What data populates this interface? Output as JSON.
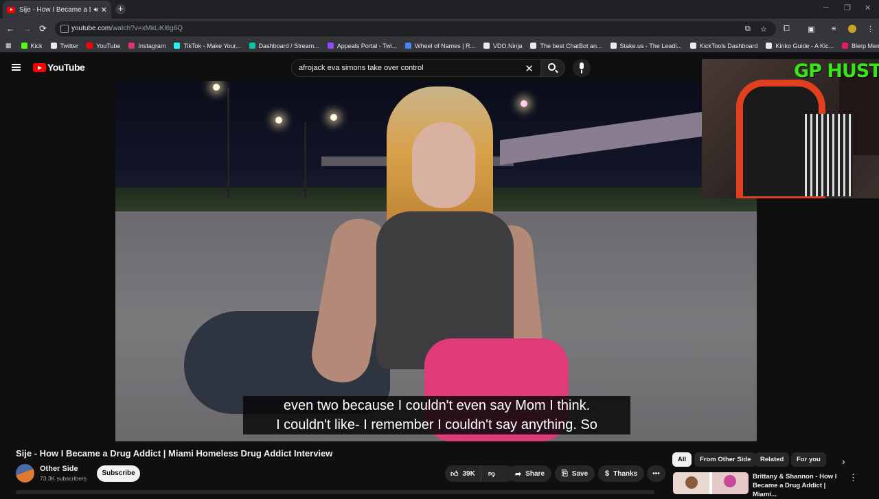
{
  "browser": {
    "tab": {
      "title": "Sije - How I Became a Drug",
      "new_tab": "+"
    },
    "window_controls": {
      "minimize": "─",
      "restore": "❐",
      "close": "✕"
    },
    "nav": {
      "back": "←",
      "forward": "→",
      "reload": "⟳"
    },
    "url": {
      "host": "youtube.com",
      "path": "/watch?v=xMkLiKl6g6Q"
    },
    "bookmarks": [
      {
        "label": "Kick",
        "color": "#53fc18"
      },
      {
        "label": "Twitter",
        "color": "#e8eaed"
      },
      {
        "label": "YouTube",
        "color": "#ff0000"
      },
      {
        "label": "Instagram",
        "color": "#e1306c"
      },
      {
        "label": "TikTok - Make Your...",
        "color": "#25f4ee"
      },
      {
        "label": "Dashboard / Stream...",
        "color": "#00c8a0"
      },
      {
        "label": "Appeals Portal - Twi...",
        "color": "#9146ff"
      },
      {
        "label": "Wheel of Names | R...",
        "color": "#4285f4"
      },
      {
        "label": "VDO.Ninja",
        "color": "#e8eaed"
      },
      {
        "label": "The best ChatBot an...",
        "color": "#e8eaed"
      },
      {
        "label": "Stake.us - The Leadi...",
        "color": "#e8eaed"
      },
      {
        "label": "KickTools Dashboard",
        "color": "#e8eaed"
      },
      {
        "label": "Kinko Guide - A Kic...",
        "color": "#e8eaed"
      },
      {
        "label": "Blerp Memes | Best...",
        "color": "#e5195f"
      }
    ]
  },
  "youtube": {
    "logo": "YouTube",
    "search": {
      "query": "afrojack eva simons take over control"
    },
    "video": {
      "caption_line1": "even two because I couldn't even say Mom I think.",
      "caption_line2": "I couldn't like- I remember I couldn't say anything. So",
      "title": "Sije - How I Became a Drug Addict | Miami Homeless Drug Addict Interview"
    },
    "stream_overlay": {
      "label": "GP HUSTLA"
    },
    "channel": {
      "name": "Other Side",
      "subscribers": "73.3K subscribers",
      "subscribe_label": "Subscribe"
    },
    "actions": {
      "likes": "39K",
      "share": "Share",
      "save": "Save",
      "thanks": "Thanks",
      "more": "•••"
    },
    "chips": [
      "All",
      "From Other Side",
      "Related",
      "For you"
    ],
    "recommendation": {
      "title": "Brittany & Shannon - How I Became a Drug Addict | Miami..."
    }
  }
}
